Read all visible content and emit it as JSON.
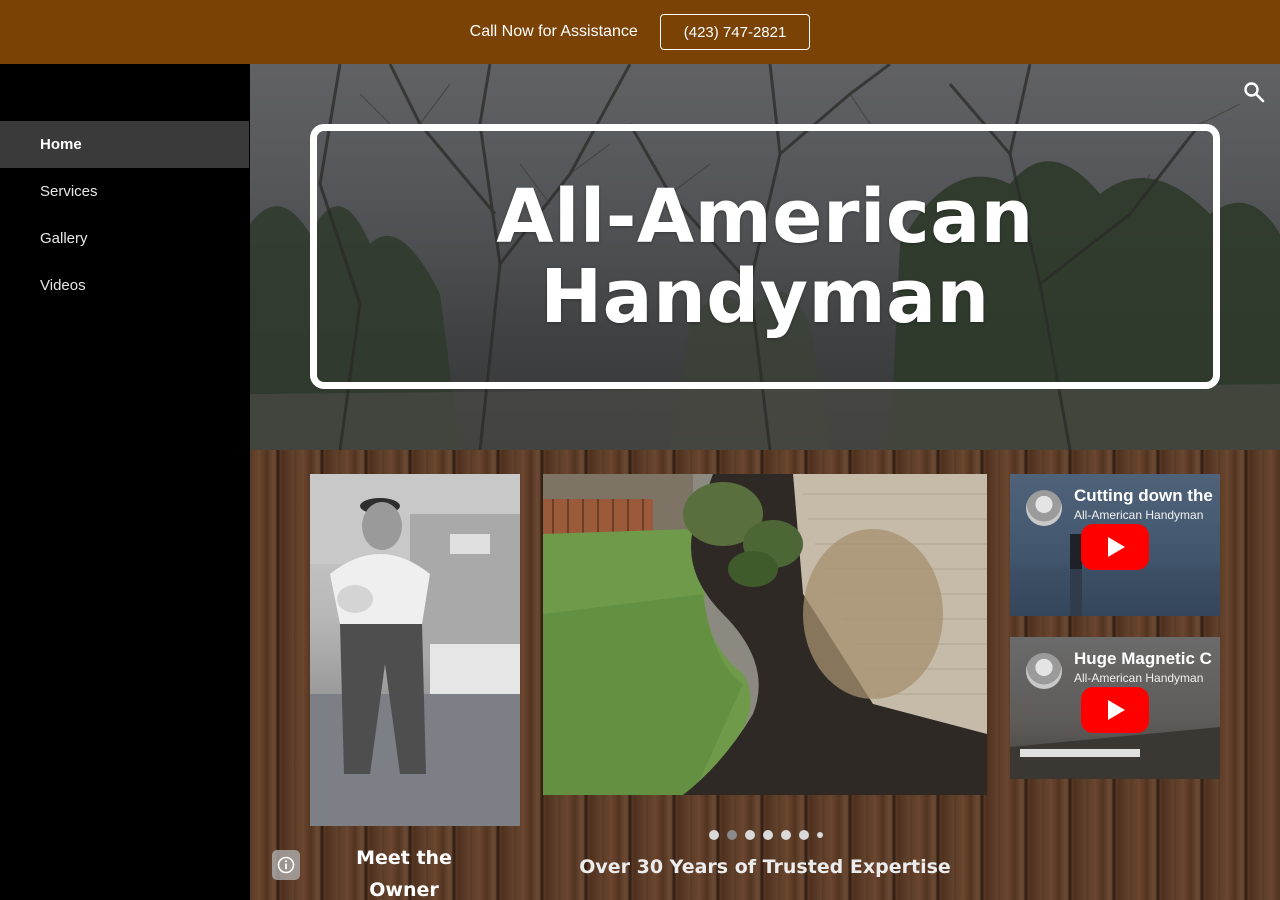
{
  "banner": {
    "text": "Call Now for Assistance",
    "phone": "(423) 747-2821",
    "background": "#7a4205"
  },
  "sidebar": {
    "items": [
      {
        "label": "Home",
        "active": true
      },
      {
        "label": "Services",
        "active": false
      },
      {
        "label": "Gallery",
        "active": false
      },
      {
        "label": "Videos",
        "active": false
      }
    ]
  },
  "hero": {
    "title": "All-American Handyman",
    "search_icon": "search-icon"
  },
  "content": {
    "owner_heading": "Meet the Owner",
    "info_icon": "info-icon",
    "carousel": {
      "slide_count": 7,
      "active_index": 1
    },
    "tagline": "Over 30 Years of Trusted Expertise"
  },
  "videos": [
    {
      "title": "Cutting down the",
      "channel": "All-American Handyman"
    },
    {
      "title": "Huge Magnetic C",
      "channel": "All-American Handyman"
    }
  ]
}
